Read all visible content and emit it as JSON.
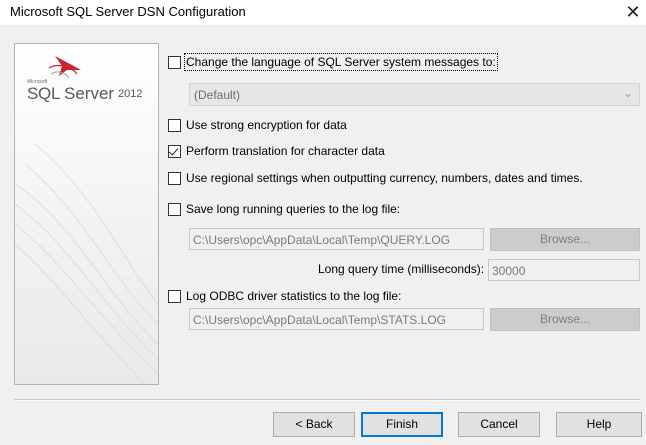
{
  "window": {
    "title": "Microsoft SQL Server DSN Configuration",
    "close_glyph": "✕"
  },
  "logo": {
    "microsoft": "Microsoft",
    "product": "SQL",
    "product2": "Server",
    "year": "2012"
  },
  "options": {
    "change_language": {
      "label": "Change the language of SQL Server system messages to:",
      "checked": false
    },
    "language_value": "(Default)",
    "strong_encryption": {
      "label": "Use strong encryption for data",
      "checked": false
    },
    "translation": {
      "label": "Perform translation for character data",
      "checked": true
    },
    "regional": {
      "label": "Use regional settings when outputting currency, numbers, dates and times.",
      "checked": false
    },
    "long_queries": {
      "label": "Save long running queries to the log file:",
      "checked": false
    },
    "query_log_path": "C:\\Users\\opc\\AppData\\Local\\Temp\\QUERY.LOG",
    "browse_label": "Browse...",
    "long_query_time_label": "Long query time (milliseconds):",
    "long_query_time_value": "30000",
    "odbc_stats": {
      "label": "Log ODBC driver statistics to the log file:",
      "checked": false
    },
    "stats_log_path": "C:\\Users\\opc\\AppData\\Local\\Temp\\STATS.LOG"
  },
  "buttons": {
    "back": "< Back",
    "finish": "Finish",
    "cancel": "Cancel",
    "help": "Help"
  }
}
